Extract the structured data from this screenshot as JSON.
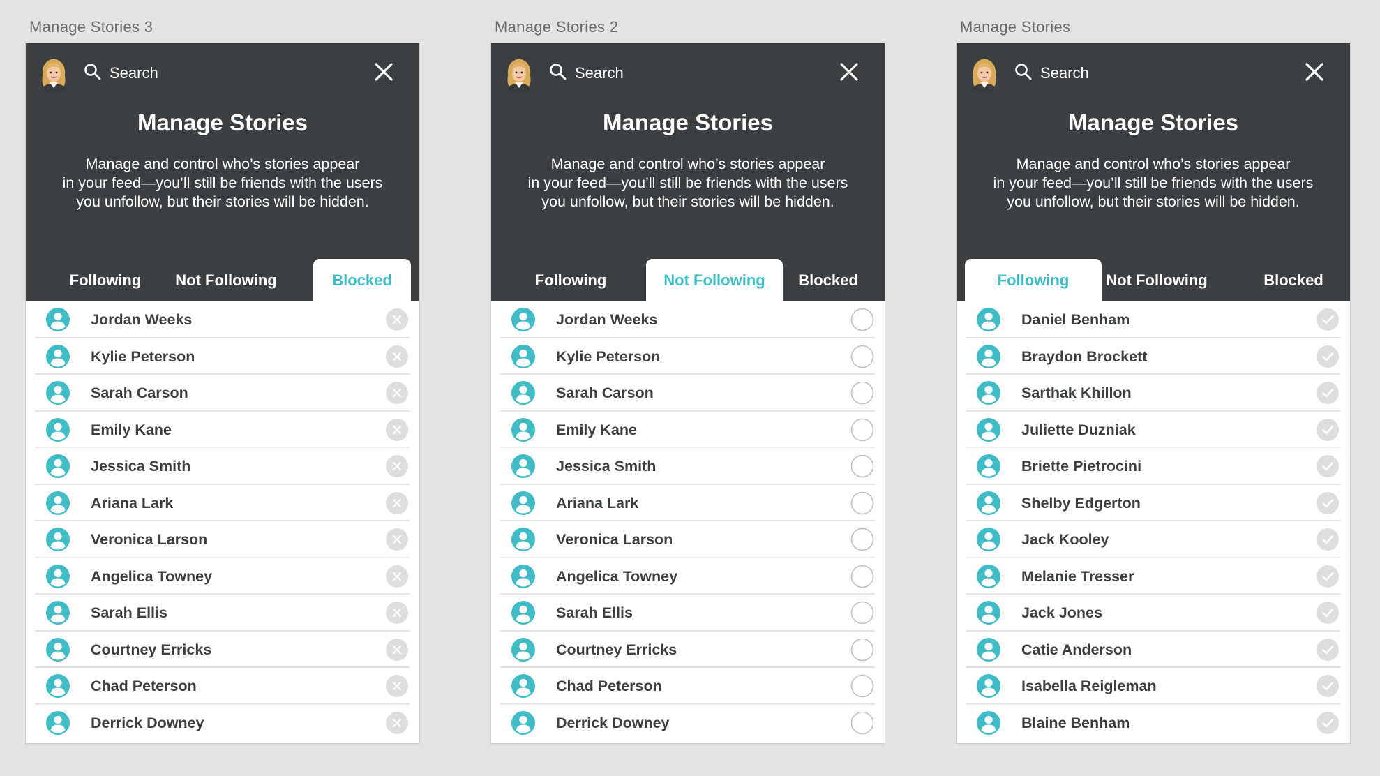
{
  "colors": {
    "accent": "#3fbcc6",
    "header_bg": "#3c3f41",
    "canvas": "#e3e3e3"
  },
  "screens": [
    {
      "label": "Manage Stories 3",
      "search_label": "Search",
      "title": "Manage Stories",
      "description_lines": [
        "Manage and control who’s stories appear",
        "in your feed—you’ll still be friends with the users",
        "you unfollow, but their stories will be hidden."
      ],
      "tabs": [
        "Following",
        "Not Following",
        "Blocked"
      ],
      "active_tab": "Blocked",
      "row_action_icon": "unblock-x-icon",
      "users": [
        "Jordan Weeks",
        "Kylie Peterson",
        "Sarah Carson",
        "Emily Kane",
        "Jessica Smith",
        "Ariana Lark",
        "Veronica Larson",
        "Angelica Towney",
        "Sarah Ellis",
        "Courtney Erricks",
        "Chad Peterson",
        "Derrick Downey"
      ]
    },
    {
      "label": "Manage Stories 2",
      "search_label": "Search",
      "title": "Manage Stories",
      "description_lines": [
        "Manage and control who’s stories appear",
        "in your feed—you’ll still be friends with the users",
        "you unfollow, but their stories will be hidden."
      ],
      "tabs": [
        "Following",
        "Not Following",
        "Blocked"
      ],
      "active_tab": "Not Following",
      "row_action_icon": "empty-circle-icon",
      "users": [
        "Jordan Weeks",
        "Kylie Peterson",
        "Sarah Carson",
        "Emily Kane",
        "Jessica Smith",
        "Ariana Lark",
        "Veronica Larson",
        "Angelica Towney",
        "Sarah Ellis",
        "Courtney Erricks",
        "Chad Peterson",
        "Derrick Downey"
      ]
    },
    {
      "label": "Manage Stories",
      "search_label": "Search",
      "title": "Manage Stories",
      "description_lines": [
        "Manage and control who’s stories appear",
        "in your feed—you’ll still be friends with the users",
        "you unfollow, but their stories will be hidden."
      ],
      "tabs": [
        "Following",
        "Not Following",
        "Blocked"
      ],
      "active_tab": "Following",
      "row_action_icon": "checkmark-icon",
      "users": [
        "Daniel Benham",
        "Braydon Brockett",
        "Sarthak Khillon",
        "Juliette Duzniak",
        "Briette Pietrocini",
        "Shelby Edgerton",
        "Jack Kooley",
        "Melanie Tresser",
        "Jack Jones",
        "Catie Anderson",
        "Isabella Reigleman",
        "Blaine Benham"
      ]
    }
  ]
}
